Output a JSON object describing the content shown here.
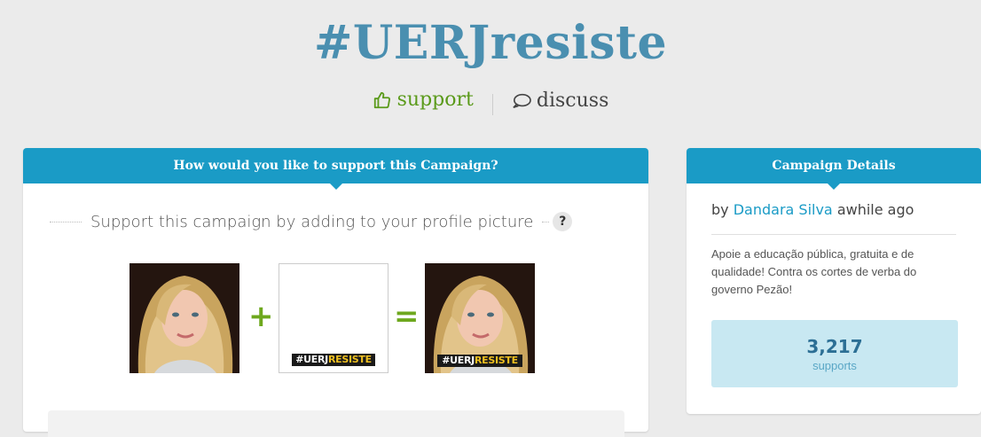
{
  "campaign": {
    "title": "#UERJresiste",
    "support_label": "support",
    "discuss_label": "discuss"
  },
  "support_card": {
    "header": "How would you like to support this Campaign?",
    "subtitle": "Support this campaign by adding to your profile picture",
    "help_label": "?",
    "plus": "+",
    "equals": "=",
    "badge_hash": "#",
    "badge_uerj": "UERJ",
    "badge_resiste": "RESISTE"
  },
  "details_card": {
    "header": "Campaign Details",
    "by": "by",
    "author": "Dandara Silva",
    "time": "awhile ago",
    "description": "Apoie a educação pública, gratuita e de qualidade! Contra os cortes de verba do governo Pezão!",
    "supports_count": "3,217",
    "supports_label": "supports"
  },
  "colors": {
    "accent": "#1a9bc6",
    "title": "#4a8fb0",
    "support_green": "#5a9a1a",
    "stat_bg": "#c8e8f2"
  }
}
